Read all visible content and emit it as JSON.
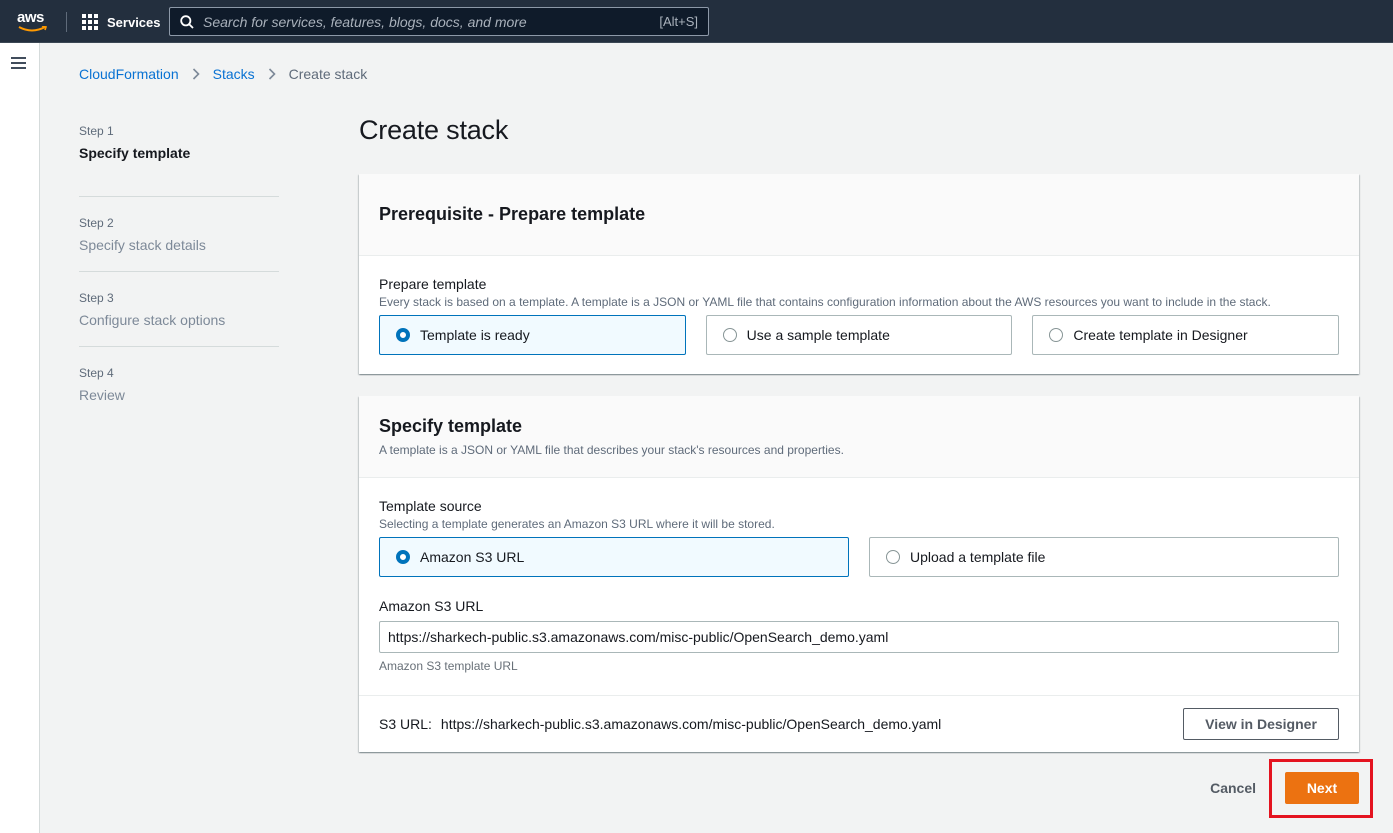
{
  "nav": {
    "logo_text": "aws",
    "services_label": "Services",
    "search_placeholder": "Search for services, features, blogs, docs, and more",
    "search_shortcut": "[Alt+S]"
  },
  "breadcrumb": {
    "items": [
      "CloudFormation",
      "Stacks"
    ],
    "current": "Create stack"
  },
  "steps": [
    {
      "num": "Step 1",
      "title": "Specify template"
    },
    {
      "num": "Step 2",
      "title": "Specify stack details"
    },
    {
      "num": "Step 3",
      "title": "Configure stack options"
    },
    {
      "num": "Step 4",
      "title": "Review"
    }
  ],
  "page_title": "Create stack",
  "prerequisite": {
    "heading": "Prerequisite - Prepare template",
    "label": "Prepare template",
    "description": "Every stack is based on a template. A template is a JSON or YAML file that contains configuration information about the AWS resources you want to include in the stack.",
    "options": [
      "Template is ready",
      "Use a sample template",
      "Create template in Designer"
    ],
    "selected": "Template is ready"
  },
  "specify": {
    "heading": "Specify template",
    "description": "A template is a JSON or YAML file that describes your stack's resources and properties.",
    "source_label": "Template source",
    "source_description": "Selecting a template generates an Amazon S3 URL where it will be stored.",
    "options": [
      "Amazon S3 URL",
      "Upload a template file"
    ],
    "selected": "Amazon S3 URL",
    "url_label": "Amazon S3 URL",
    "url_value": "https://sharkech-public.s3.amazonaws.com/misc-public/OpenSearch_demo.yaml",
    "url_help": "Amazon S3 template URL",
    "s3_url_label": "S3 URL:",
    "s3_url_value": "https://sharkech-public.s3.amazonaws.com/misc-public/OpenSearch_demo.yaml",
    "view_designer_label": "View in Designer"
  },
  "actions": {
    "cancel_label": "Cancel",
    "next_label": "Next"
  },
  "colors": {
    "nav_bg": "#232f3e",
    "link": "#0972d3",
    "primary": "#ec7211",
    "selected_border": "#0073bb",
    "highlight": "#e4131f"
  }
}
